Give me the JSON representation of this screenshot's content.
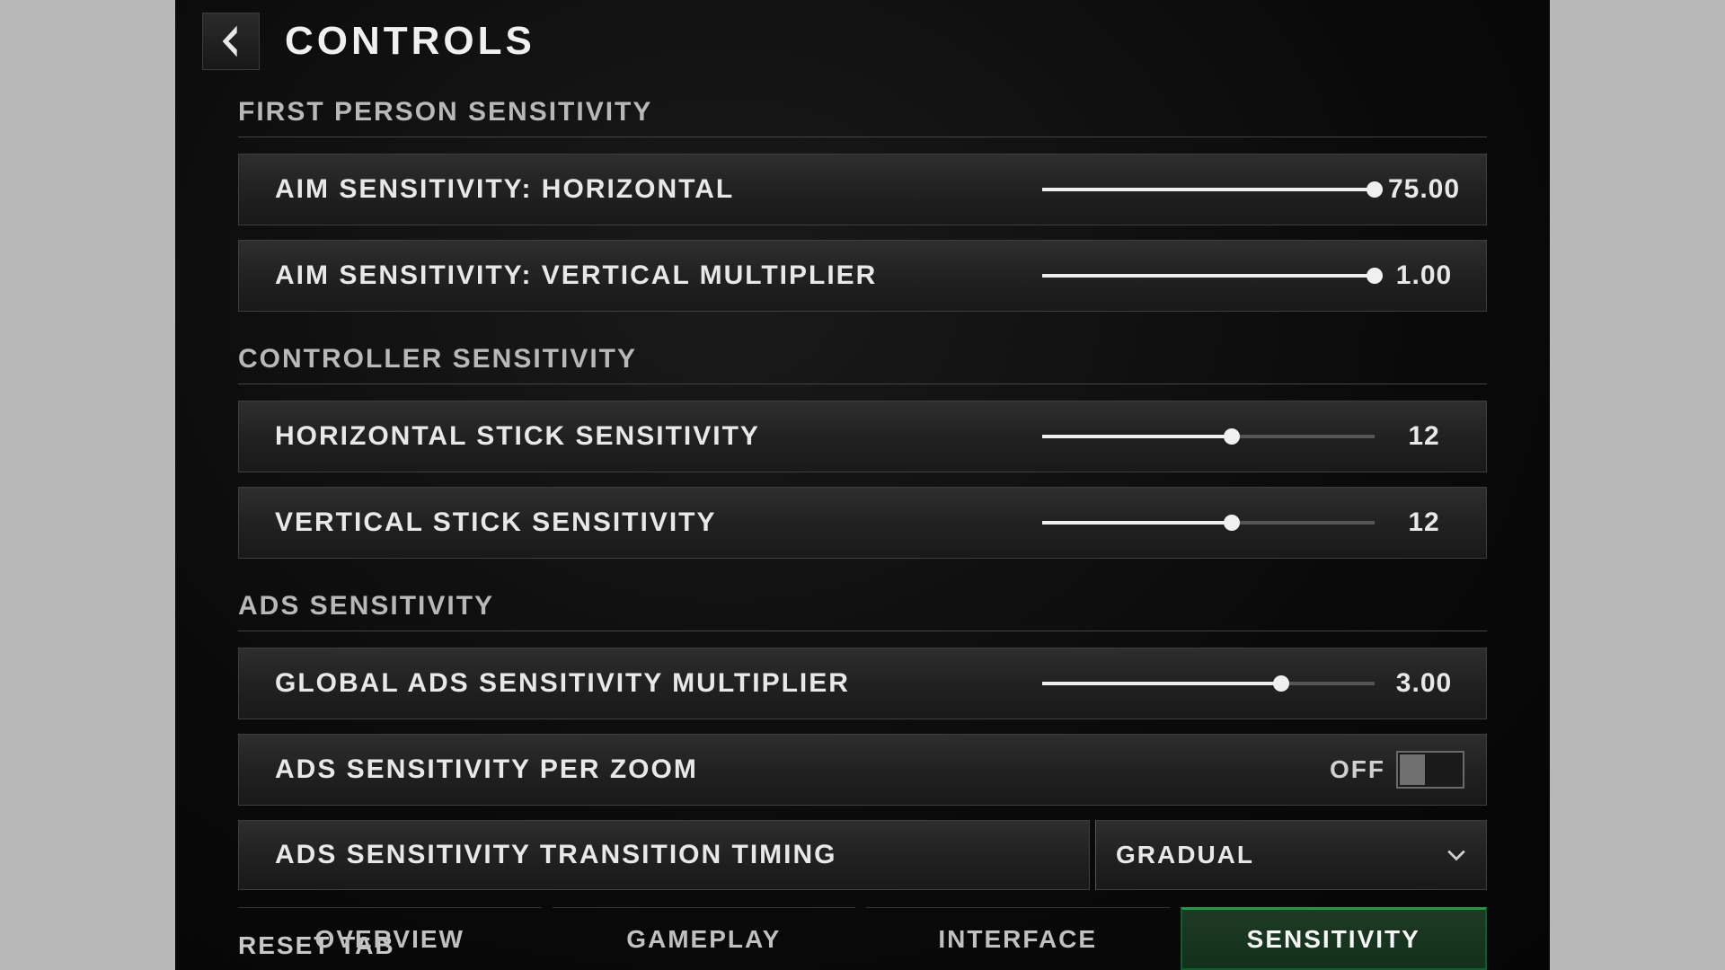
{
  "header": {
    "title": "CONTROLS"
  },
  "sections": {
    "fps": {
      "label": "FIRST PERSON SENSITIVITY",
      "aim_h": {
        "label": "AIM SENSITIVITY: HORIZONTAL",
        "value": "75.00",
        "pct": 100
      },
      "aim_v": {
        "label": "AIM SENSITIVITY: VERTICAL MULTIPLIER",
        "value": "1.00",
        "pct": 100
      }
    },
    "controller": {
      "label": "CONTROLLER SENSITIVITY",
      "h": {
        "label": "HORIZONTAL STICK SENSITIVITY",
        "value": "12",
        "pct": 57
      },
      "v": {
        "label": "VERTICAL STICK SENSITIVITY",
        "value": "12",
        "pct": 57
      }
    },
    "ads": {
      "label": "ADS SENSITIVITY",
      "global": {
        "label": "GLOBAL ADS SENSITIVITY MULTIPLIER",
        "value": "3.00",
        "pct": 72
      },
      "per_zoom": {
        "label": "ADS SENSITIVITY PER ZOOM",
        "value": "OFF"
      },
      "timing": {
        "label": "ADS SENSITIVITY TRANSITION TIMING",
        "value": "GRADUAL"
      }
    }
  },
  "reset_label": "RESET TAB",
  "tabs": {
    "overview": "OVERVIEW",
    "gameplay": "GAMEPLAY",
    "interface": "INTERFACE",
    "sensitivity": "SENSITIVITY"
  }
}
